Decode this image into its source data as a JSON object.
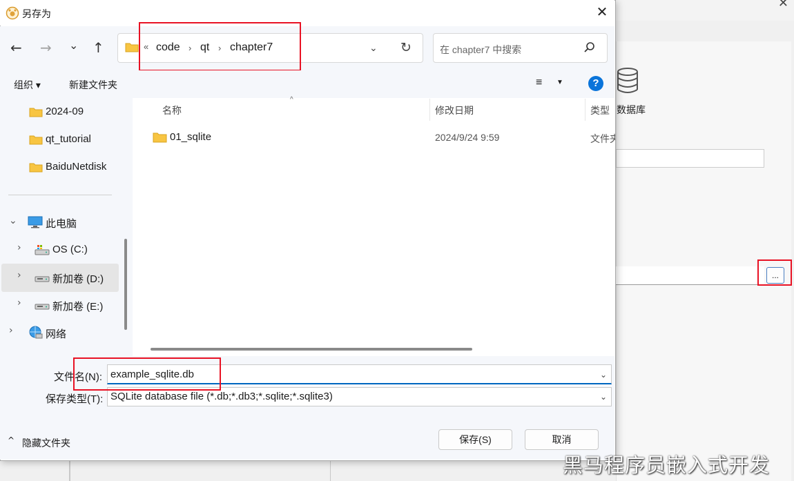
{
  "dialog": {
    "title": "另存为",
    "close_glyph": "✕"
  },
  "nav": {
    "back_glyph": "←",
    "forward_glyph": "→",
    "recent_glyph": "⌄",
    "up_glyph": "↑",
    "address": {
      "overflow": "«",
      "crumbs": [
        "code",
        "qt",
        "chapter7"
      ],
      "separator": "›",
      "dropdown_glyph": "⌄"
    },
    "refresh_glyph": "↻",
    "search_placeholder": "在 chapter7 中搜索"
  },
  "toolbar": {
    "organize_label": "组织 ▾",
    "new_folder_label": "新建文件夹",
    "view_glyph": "≡",
    "view_caret": "▼",
    "help_glyph": "?"
  },
  "nav_pane": {
    "items": [
      {
        "label": "2024-09"
      },
      {
        "label": "qt_tutorial"
      },
      {
        "label": "BaiduNetdisk"
      },
      {
        "label": "此电脑"
      },
      {
        "label": "OS (C:)"
      },
      {
        "label": "新加卷 (D:)"
      },
      {
        "label": "新加卷 (E:)"
      },
      {
        "label": "网络"
      }
    ],
    "chevron_right": "›",
    "chevron_down": "⌄"
  },
  "file_list": {
    "columns": [
      "名称",
      "修改日期",
      "类型"
    ],
    "sort_glyph": "^",
    "rows": [
      {
        "name": "01_sqlite",
        "date": "2024/9/24 9:59",
        "type": "文件夹"
      }
    ]
  },
  "form": {
    "filename_label": "文件名(N):",
    "filename_value": "example_sqlite.db",
    "type_label": "保存类型(T):",
    "type_value": "SQLite database file (*.db;*.db3;*.sqlite;*.sqlite3)",
    "caret_glyph": "⌄",
    "hide_folders_caret": "^",
    "hide_folders_label": "隐藏文件夹",
    "save_label": "保存(S)",
    "cancel_label": "取消"
  },
  "background_app": {
    "db_label": "数据库",
    "browse_label": "...",
    "close_glyph": "✕"
  },
  "watermark": "黑马程序员嵌入式开发",
  "colors": {
    "accent": "#0067c0",
    "annotation": "#e81123",
    "folder": "#f8c542"
  }
}
